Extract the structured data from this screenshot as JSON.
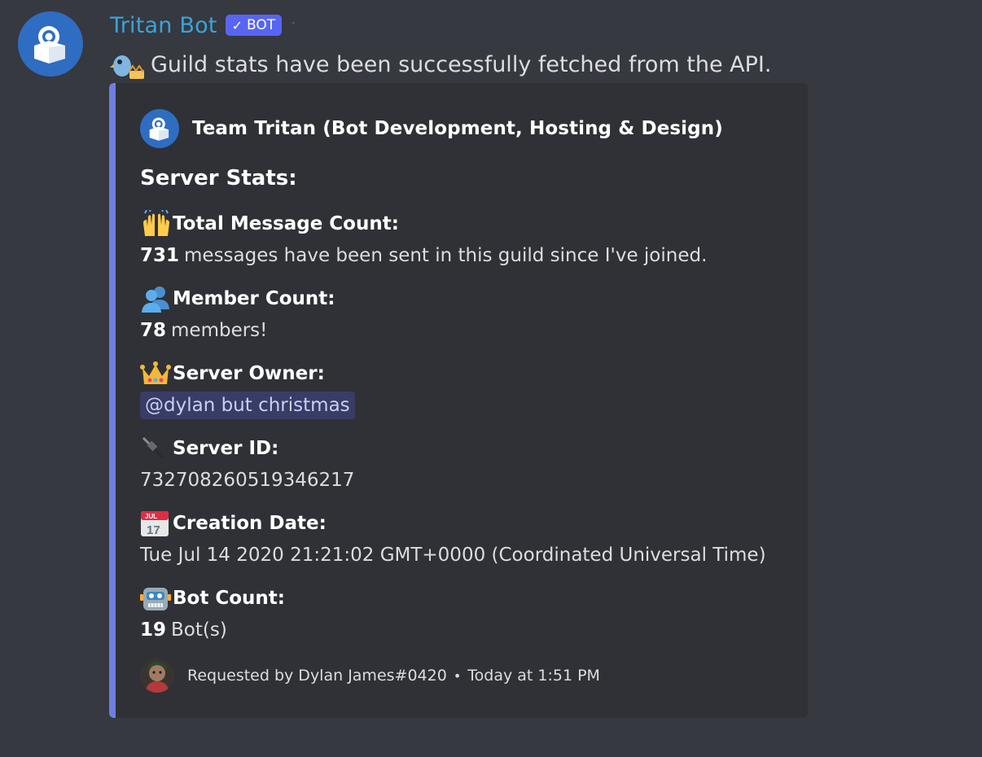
{
  "message": {
    "username": "Tritan Bot",
    "bot_tag": "BOT",
    "content": "Guild stats have been successfully fetched from the API.",
    "avatar_icon": "tritan-logo-icon",
    "colors": {
      "username": "#3aa3dc",
      "bot_tag": "#5865f2",
      "embed_border": "#6f7ee0"
    }
  },
  "embed": {
    "author": "Team Tritan (Bot Development, Hosting & Design)",
    "title": "Server Stats:",
    "fields": [
      {
        "icon": "raising-hands-icon",
        "name": "Total Message Count:",
        "value_bold": "731",
        "value_text": "messages have been sent in this guild since I've joined."
      },
      {
        "icon": "busts-icon",
        "name": "Member Count:",
        "value_bold": "78",
        "value_text": "members!"
      },
      {
        "icon": "crown-icon",
        "name": "Server Owner:",
        "value_mention": "@dylan but christmas"
      },
      {
        "icon": "plug-icon",
        "name": "Server ID:",
        "value_text": "732708260519346217"
      },
      {
        "icon": "calendar-icon",
        "name": "Creation Date:",
        "value_text": "Tue Jul 14 2020 21:21:02 GMT+0000 (Coordinated Universal Time)",
        "calendar_month": "JUL",
        "calendar_day": "17"
      },
      {
        "icon": "robot-icon",
        "name": "Bot Count:",
        "value_bold": "19",
        "value_text": "Bot(s)"
      }
    ],
    "footer": {
      "requested_by": "Requested by Dylan James#0420",
      "separator": "•",
      "timestamp": "Today at 1:51 PM"
    }
  }
}
